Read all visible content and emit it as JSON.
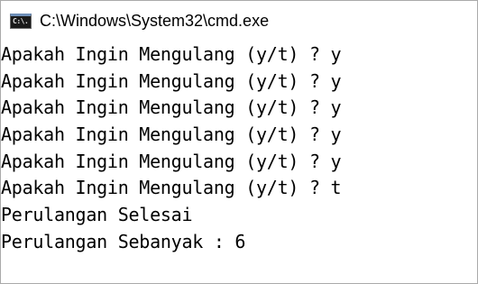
{
  "window": {
    "title": "C:\\Windows\\System32\\cmd.exe",
    "icon": "cmd-icon",
    "icon_text": "C:\\."
  },
  "console": {
    "lines": [
      "Apakah Ingin Mengulang (y/t) ? y",
      "Apakah Ingin Mengulang (y/t) ? y",
      "Apakah Ingin Mengulang (y/t) ? y",
      "Apakah Ingin Mengulang (y/t) ? y",
      "Apakah Ingin Mengulang (y/t) ? y",
      "Apakah Ingin Mengulang (y/t) ? t",
      "Perulangan Selesai",
      "Perulangan Sebanyak : 6"
    ]
  },
  "colors": {
    "background": "#ffffff",
    "text": "#000000"
  }
}
